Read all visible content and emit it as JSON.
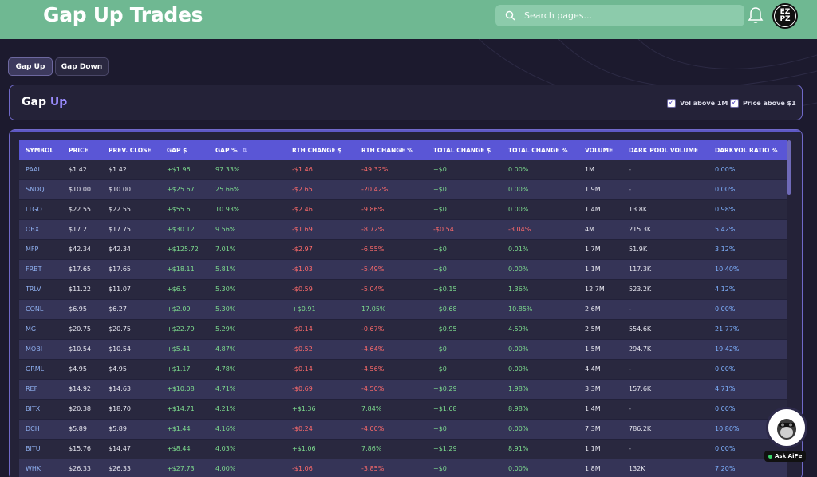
{
  "header": {
    "title": "Gap Up Trades",
    "search_placeholder": "Search pages...",
    "avatar_text": "EZ PZ"
  },
  "tabs": [
    {
      "label": "Gap Up",
      "active": true
    },
    {
      "label": "Gap Down",
      "active": false
    }
  ],
  "section": {
    "title_main": "Gap",
    "title_accent": "Up",
    "filters": [
      {
        "label": "Vol above 1M",
        "checked": true
      },
      {
        "label": "Price above $1",
        "checked": true
      }
    ]
  },
  "table": {
    "columns": [
      "SYMBOL",
      "PRICE",
      "PREV. CLOSE",
      "GAP $",
      "GAP %",
      "RTH CHANGE $",
      "RTH CHANGE %",
      "TOTAL CHANGE $",
      "TOTAL CHANGE %",
      "VOLUME",
      "DARK POOL VOLUME",
      "DARKVOL RATIO %"
    ],
    "sort_column": "GAP %",
    "rows": [
      [
        "PAAI",
        "$1.42",
        "$1.42",
        "+$1.96",
        "97.33%",
        "-$1.46",
        "-49.32%",
        "+$0",
        "0.00%",
        "1M",
        "-",
        "0.00%"
      ],
      [
        "SNDQ",
        "$10.00",
        "$10.00",
        "+$25.67",
        "25.66%",
        "-$2.65",
        "-20.42%",
        "+$0",
        "0.00%",
        "1.9M",
        "-",
        "0.00%"
      ],
      [
        "LTGO",
        "$22.55",
        "$22.55",
        "+$55.6",
        "10.93%",
        "-$2.46",
        "-9.86%",
        "+$0",
        "0.00%",
        "1.4M",
        "13.8K",
        "0.98%"
      ],
      [
        "OBX",
        "$17.21",
        "$17.75",
        "+$30.12",
        "9.56%",
        "-$1.69",
        "-8.72%",
        "-$0.54",
        "-3.04%",
        "4M",
        "215.3K",
        "5.42%"
      ],
      [
        "MFP",
        "$42.34",
        "$42.34",
        "+$125.72",
        "7.01%",
        "-$2.97",
        "-6.55%",
        "+$0",
        "0.01%",
        "1.7M",
        "51.9K",
        "3.12%"
      ],
      [
        "FRBT",
        "$17.65",
        "$17.65",
        "+$18.11",
        "5.81%",
        "-$1.03",
        "-5.49%",
        "+$0",
        "0.00%",
        "1.1M",
        "117.3K",
        "10.40%"
      ],
      [
        "TRLV",
        "$11.22",
        "$11.07",
        "+$6.5",
        "5.30%",
        "-$0.59",
        "-5.04%",
        "+$0.15",
        "1.36%",
        "12.7M",
        "523.2K",
        "4.12%"
      ],
      [
        "CONL",
        "$6.95",
        "$6.27",
        "+$2.09",
        "5.30%",
        "+$0.91",
        "17.05%",
        "+$0.68",
        "10.85%",
        "2.6M",
        "-",
        "0.00%"
      ],
      [
        "MG",
        "$20.75",
        "$20.75",
        "+$22.79",
        "5.29%",
        "-$0.14",
        "-0.67%",
        "+$0.95",
        "4.59%",
        "2.5M",
        "554.6K",
        "21.77%"
      ],
      [
        "MOBI",
        "$10.54",
        "$10.54",
        "+$5.41",
        "4.87%",
        "-$0.52",
        "-4.64%",
        "+$0",
        "0.00%",
        "1.5M",
        "294.7K",
        "19.42%"
      ],
      [
        "GRML",
        "$4.95",
        "$4.95",
        "+$1.17",
        "4.78%",
        "-$0.14",
        "-4.56%",
        "+$0",
        "0.00%",
        "4.4M",
        "-",
        "0.00%"
      ],
      [
        "REF",
        "$14.92",
        "$14.63",
        "+$10.08",
        "4.71%",
        "-$0.69",
        "-4.50%",
        "+$0.29",
        "1.98%",
        "3.3M",
        "157.6K",
        "4.71%"
      ],
      [
        "BITX",
        "$20.38",
        "$18.70",
        "+$14.71",
        "4.21%",
        "+$1.36",
        "7.84%",
        "+$1.68",
        "8.98%",
        "1.4M",
        "-",
        "0.00%"
      ],
      [
        "DCH",
        "$5.89",
        "$5.89",
        "+$1.44",
        "4.16%",
        "-$0.24",
        "-4.00%",
        "+$0",
        "0.00%",
        "7.3M",
        "786.2K",
        "10.80%"
      ],
      [
        "BITU",
        "$15.76",
        "$14.47",
        "+$8.44",
        "4.03%",
        "+$1.06",
        "7.86%",
        "+$1.29",
        "8.91%",
        "1.1M",
        "-",
        "0.00%"
      ],
      [
        "WHK",
        "$26.33",
        "$26.33",
        "+$27.73",
        "4.00%",
        "-$1.06",
        "-3.85%",
        "+$0",
        "0.00%",
        "1.8M",
        "132K",
        "7.20%"
      ]
    ]
  },
  "assistant": {
    "label": "Ask AiPe"
  },
  "colors": {
    "header_bg": "#6fb892",
    "page_bg": "#1c1a2e",
    "table_header": "#5a56d6",
    "accent": "#9b8cff",
    "positive": "#7ddc8e",
    "negative": "#ff6b6b"
  }
}
